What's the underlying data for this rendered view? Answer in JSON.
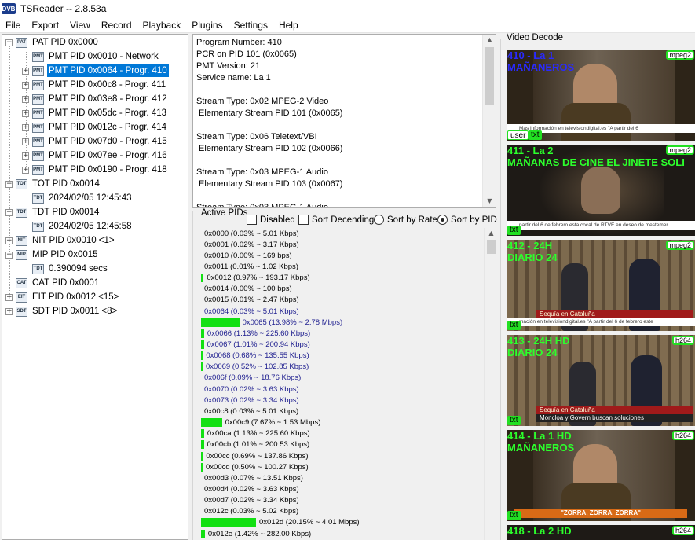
{
  "window": {
    "title": "TSReader -- 2.8.53a",
    "icon_text": "DVB"
  },
  "menu": [
    "File",
    "Export",
    "View",
    "Record",
    "Playback",
    "Plugins",
    "Settings",
    "Help"
  ],
  "tree": {
    "nodes": [
      {
        "label": "PAT PID 0x0000",
        "level": 0,
        "expander": "−",
        "icon": "PAT"
      },
      {
        "label": "PMT PID 0x0010 - Network",
        "level": 1,
        "expander": "",
        "icon": "PMT"
      },
      {
        "label": "PMT PID 0x0064 - Progr. 410",
        "level": 1,
        "expander": "+",
        "icon": "PMT",
        "selected": true
      },
      {
        "label": "PMT PID 0x00c8 - Progr. 411",
        "level": 1,
        "expander": "+",
        "icon": "PMT"
      },
      {
        "label": "PMT PID 0x03e8 - Progr. 412",
        "level": 1,
        "expander": "+",
        "icon": "PMT"
      },
      {
        "label": "PMT PID 0x05dc - Progr. 413",
        "level": 1,
        "expander": "+",
        "icon": "PMT"
      },
      {
        "label": "PMT PID 0x012c - Progr. 414",
        "level": 1,
        "expander": "+",
        "icon": "PMT"
      },
      {
        "label": "PMT PID 0x07d0 - Progr. 415",
        "level": 1,
        "expander": "+",
        "icon": "PMT"
      },
      {
        "label": "PMT PID 0x07ee - Progr. 416",
        "level": 1,
        "expander": "+",
        "icon": "PMT"
      },
      {
        "label": "PMT PID 0x0190 - Progr. 418",
        "level": 1,
        "expander": "+",
        "icon": "PMT"
      },
      {
        "label": "TOT PID 0x0014",
        "level": 0,
        "expander": "−",
        "icon": "TOT"
      },
      {
        "label": "2024/02/05 12:45:43",
        "level": 1,
        "expander": "",
        "icon": "TDT"
      },
      {
        "label": "TDT PID 0x0014",
        "level": 0,
        "expander": "−",
        "icon": "TDT"
      },
      {
        "label": "2024/02/05 12:45:58",
        "level": 1,
        "expander": "",
        "icon": "TDT"
      },
      {
        "label": "NIT PID 0x0010 <1>",
        "level": 0,
        "expander": "+",
        "icon": "NIT"
      },
      {
        "label": "MIP PID 0x0015",
        "level": 0,
        "expander": "−",
        "icon": "MIP"
      },
      {
        "label": "0.390094 secs",
        "level": 1,
        "expander": "",
        "icon": "TDT"
      },
      {
        "label": "CAT PID 0x0001",
        "level": 0,
        "expander": "",
        "icon": "CAT"
      },
      {
        "label": "EIT PID 0x0012 <15>",
        "level": 0,
        "expander": "+",
        "icon": "EIT"
      },
      {
        "label": "SDT PID 0x0011 <8>",
        "level": 0,
        "expander": "+",
        "icon": "SDT"
      }
    ]
  },
  "program_info": [
    "Program Number: 410",
    "PCR on PID 101 (0x0065)",
    "PMT Version: 21",
    "Service name: La 1",
    "",
    "Stream Type: 0x02 MPEG-2 Video",
    " Elementary Stream PID 101 (0x0065)",
    "",
    "Stream Type: 0x06 Teletext/VBI",
    " Elementary Stream PID 102 (0x0066)",
    "",
    "Stream Type: 0x03 MPEG-1 Audio",
    " Elementary Stream PID 103 (0x0067)",
    "",
    "Stream Type: 0x03 MPEG-1 Audio"
  ],
  "active_pids": {
    "caption": "Active PIDs",
    "options": {
      "disabled": {
        "label": "Disabled",
        "checked": false
      },
      "sort_descending": {
        "label": "Sort Decending",
        "checked": false
      },
      "sort_by_rate": {
        "label": "Sort by Rate",
        "selected": false
      },
      "sort_by_pid": {
        "label": "Sort by PID",
        "selected": true
      }
    },
    "rows": [
      {
        "text": "0x0000 (0.03% ~ 5.01 Kbps)",
        "percent": 0.03,
        "blue": false
      },
      {
        "text": "0x0001 (0.02% ~ 3.17 Kbps)",
        "percent": 0.02,
        "blue": false
      },
      {
        "text": "0x0010 (0.00% ~ 169 bps)",
        "percent": 0.0,
        "blue": false
      },
      {
        "text": "0x0011 (0.01% ~ 1.02 Kbps)",
        "percent": 0.01,
        "blue": false
      },
      {
        "text": "0x0012 (0.97% ~ 193.17 Kbps)",
        "percent": 0.97,
        "blue": false
      },
      {
        "text": "0x0014 (0.00% ~ 100 bps)",
        "percent": 0.0,
        "blue": false
      },
      {
        "text": "0x0015 (0.01% ~ 2.47 Kbps)",
        "percent": 0.01,
        "blue": false
      },
      {
        "text": "0x0064 (0.03% ~ 5.01 Kbps)",
        "percent": 0.03,
        "blue": true
      },
      {
        "text": "0x0065 (13.98% ~ 2.78 Mbps)",
        "percent": 13.98,
        "blue": true
      },
      {
        "text": "0x0066 (1.13% ~ 225.60 Kbps)",
        "percent": 1.13,
        "blue": true
      },
      {
        "text": "0x0067 (1.01% ~ 200.94 Kbps)",
        "percent": 1.01,
        "blue": true
      },
      {
        "text": "0x0068 (0.68% ~ 135.55 Kbps)",
        "percent": 0.68,
        "blue": true
      },
      {
        "text": "0x0069 (0.52% ~ 102.85 Kbps)",
        "percent": 0.52,
        "blue": true
      },
      {
        "text": "0x006f (0.09% ~ 18.76 Kbps)",
        "percent": 0.09,
        "blue": true
      },
      {
        "text": "0x0070 (0.02% ~ 3.63 Kbps)",
        "percent": 0.02,
        "blue": true
      },
      {
        "text": "0x0073 (0.02% ~ 3.34 Kbps)",
        "percent": 0.02,
        "blue": true
      },
      {
        "text": "0x00c8 (0.03% ~ 5.01 Kbps)",
        "percent": 0.03,
        "blue": false
      },
      {
        "text": "0x00c9 (7.67% ~ 1.53 Mbps)",
        "percent": 7.67,
        "blue": false
      },
      {
        "text": "0x00ca (1.13% ~ 225.60 Kbps)",
        "percent": 1.13,
        "blue": false
      },
      {
        "text": "0x00cb (1.01% ~ 200.53 Kbps)",
        "percent": 1.01,
        "blue": false
      },
      {
        "text": "0x00cc (0.69% ~ 137.86 Kbps)",
        "percent": 0.69,
        "blue": false
      },
      {
        "text": "0x00cd (0.50% ~ 100.27 Kbps)",
        "percent": 0.5,
        "blue": false
      },
      {
        "text": "0x00d3 (0.07% ~ 13.51 Kbps)",
        "percent": 0.07,
        "blue": false
      },
      {
        "text": "0x00d4 (0.02% ~ 3.63 Kbps)",
        "percent": 0.02,
        "blue": false
      },
      {
        "text": "0x00d7 (0.02% ~ 3.34 Kbps)",
        "percent": 0.02,
        "blue": false
      },
      {
        "text": "0x012c (0.03% ~ 5.02 Kbps)",
        "percent": 0.03,
        "blue": false
      },
      {
        "text": "0x012d (20.15% ~ 4.01 Mbps)",
        "percent": 20.15,
        "blue": false
      },
      {
        "text": "0x012e (1.42% ~ 282.00 Kbps)",
        "percent": 1.42,
        "blue": false
      }
    ]
  },
  "video_decode": {
    "caption": "Video Decode",
    "tiles": [
      {
        "title": "410 - La 1\nMAÑANEROS",
        "title_color": "blue",
        "codec": "mpeg2",
        "badges": [
          "user",
          "txt"
        ],
        "ticker": "Más información en televisiondigital.es     \"A partir del 6"
      },
      {
        "title": "411 - La 2\nMAÑANAS DE CINE EL JINETE SOLI",
        "title_color": "green",
        "codec": "mpeg2",
        "badges": [
          "txt"
        ],
        "ticker": "partir del 6 de febrero esta cocal de RTVE en deseo de mestemer"
      },
      {
        "title": "412 - 24H\nDIARIO 24",
        "title_color": "green",
        "codec": "mpeg2",
        "badges": [
          "txt"
        ],
        "lower_third": "Sequía en Cataluña",
        "ticker": "mación en televisiondigital.es      \"A partir del 6 de febrero este"
      },
      {
        "title": "413 - 24H HD\nDIARIO 24",
        "title_color": "green",
        "codec": "h264",
        "badges": [
          "txt"
        ],
        "lower_third": "Sequía en Cataluña",
        "headline": "Moncloa y Govern buscan soluciones"
      },
      {
        "title": "414 - La 1 HD\nMAÑANEROS",
        "title_color": "green",
        "codec": "h264",
        "badges": [
          "txt"
        ],
        "banner": "\"ZORRA, ZORRA, ZORRA\""
      },
      {
        "title": "418 - La 2 HD",
        "title_color": "green",
        "codec": "h264",
        "badges": []
      }
    ]
  },
  "colors": {
    "selection": "#0078d7",
    "bar": "#12e012",
    "osd_green": "#2cff2c",
    "osd_blue": "#2a2aff"
  }
}
